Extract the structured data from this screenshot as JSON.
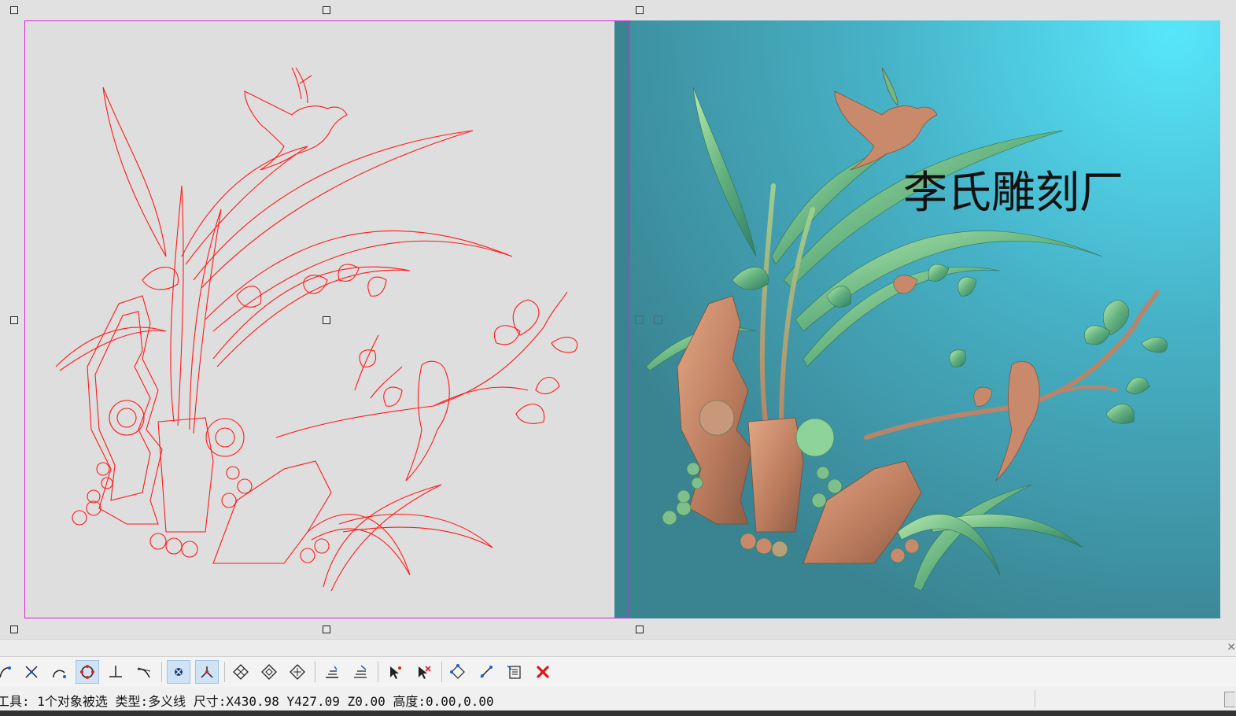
{
  "watermark": {
    "text": "李氏雕刻厂"
  },
  "status_bar": {
    "text": "工具: 1个对象被选 类型:多义线 尺寸:X430.98 Y427.09 Z0.00 高度:0.00,0.00"
  },
  "toolbar": {
    "groups": [
      [
        "curve-start-icon",
        "intersect-icon",
        "arc-icon",
        "circle-snap-icon",
        "perpendicular-icon",
        "tangent-icon"
      ],
      [
        "center-snap-icon",
        "node-snap-icon"
      ],
      [
        "diamond-grid-icon",
        "diamond-check-icon",
        "diamond-cross-icon"
      ],
      [
        "align-bottom-icon",
        "align-layers-icon"
      ],
      [
        "select-arrow-icon",
        "deselect-arrow-icon"
      ],
      [
        "transform-icon",
        "edit-node-icon",
        "list-edit-icon",
        "delete-icon"
      ]
    ],
    "active": [
      "circle-snap-icon",
      "center-snap-icon",
      "node-snap-icon"
    ]
  },
  "colors": {
    "vector_stroke": "#ff1a1a",
    "relief_bg_light": "#57e2f6",
    "relief_bg_dark": "#3f8f9e",
    "selection": "#e020e0",
    "relief_wood": "#c8896a",
    "relief_leaf": "#5fae7c"
  }
}
